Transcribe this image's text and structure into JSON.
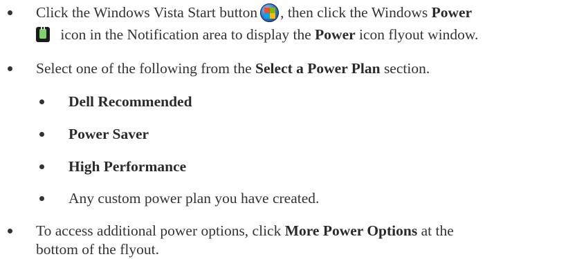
{
  "items": [
    {
      "prefix": "Click the Windows Vista Start button",
      "mid": ", then click the Windows",
      "bold1": "Power",
      "line2_text": " icon in the Notification area to display the",
      "bold2": "Power",
      "suffix": " icon flyout window.",
      "icons": [
        "windows-start-icon",
        "power-icon"
      ]
    },
    {
      "prefix": "Select one of the following from the",
      "bold": "Select a Power Plan",
      "suffix": " section."
    },
    {
      "sub": [
        {
          "bold": "Dell Recommended"
        },
        {
          "bold": "Power Saver"
        },
        {
          "bold": "High Performance"
        },
        {
          "text": "Any custom power plan you have created."
        }
      ]
    },
    {
      "prefix": "To access additional power options, click",
      "bold": "More Power Options",
      "suffix": " at the",
      "line2": "bottom of the flyout."
    }
  ]
}
